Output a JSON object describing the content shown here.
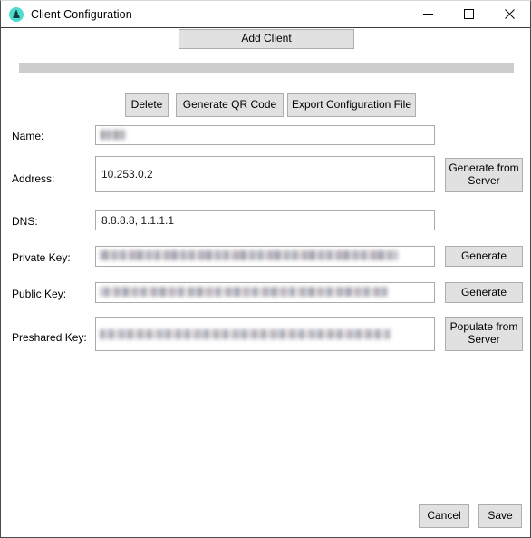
{
  "window": {
    "title": "Client Configuration",
    "icon": "wireguard-icon",
    "controls": {
      "minimize": "minimize-icon",
      "maximize": "maximize-icon",
      "close": "close-icon"
    }
  },
  "toolbar": {
    "add_client_label": "Add Client"
  },
  "actions": {
    "delete_label": "Delete",
    "generate_qr_label": "Generate QR Code",
    "export_config_label": "Export Configuration File"
  },
  "fields": [
    {
      "id": "name",
      "label": "Name:",
      "value": "",
      "placeholder": "",
      "redacted": true,
      "side_button": null
    },
    {
      "id": "address",
      "label": "Address:",
      "value": "10.253.0.2",
      "placeholder": "",
      "redacted": false,
      "side_button": "Generate from Server"
    },
    {
      "id": "dns",
      "label": "DNS:",
      "value": "8.8.8.8, 1.1.1.1",
      "placeholder": "",
      "redacted": false,
      "side_button": null
    },
    {
      "id": "private-key",
      "label": "Private Key:",
      "value": "",
      "placeholder": "",
      "redacted": true,
      "side_button": "Generate"
    },
    {
      "id": "public-key",
      "label": "Public Key:",
      "value": "",
      "placeholder": "",
      "redacted": true,
      "side_button": "Generate"
    },
    {
      "id": "preshared-key",
      "label": "Preshared Key:",
      "value": "",
      "placeholder": "",
      "redacted": true,
      "side_button": "Populate from Server"
    }
  ],
  "side_buttons": {
    "address_generate": "Generate from Server",
    "private_key_generate": "Generate",
    "public_key_generate": "Generate",
    "preshared_key_populate": "Populate from Server"
  },
  "footer": {
    "cancel_label": "Cancel",
    "save_label": "Save"
  },
  "colors": {
    "window_background": "#ffffff",
    "button_face": "#e1e1e1",
    "button_border": "#adadad",
    "input_border": "#aaaaaa",
    "list_bar": "#cdcdcd",
    "icon_accent": "#4ddbd0",
    "frame_border": "#4b4b4b"
  }
}
